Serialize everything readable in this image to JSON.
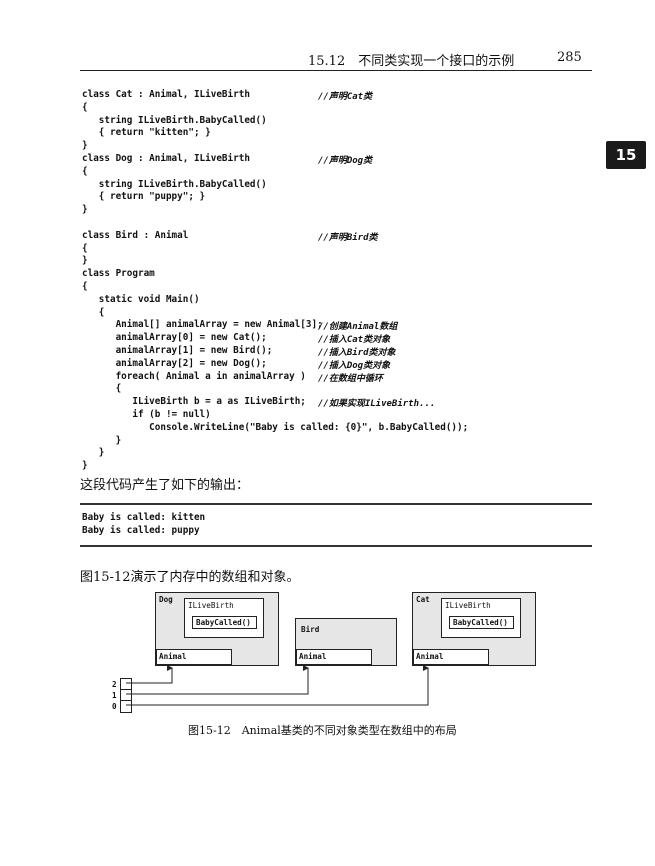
{
  "header": {
    "title": "15.12　不同类实现一个接口的示例",
    "page_number": "285"
  },
  "chapter_tab": "15",
  "code_block_1": {
    "lines": [
      "class Cat : Animal, ILiveBirth",
      "{",
      "   string ILiveBirth.BabyCalled()",
      "   { return \"kitten\"; }",
      "}",
      "class Dog : Animal, ILiveBirth",
      "{",
      "   string ILiveBirth.BabyCalled()",
      "   { return \"puppy\"; }",
      "}",
      "",
      "class Bird : Animal",
      "{",
      "}",
      "class Program",
      "{",
      "   static void Main()",
      "   {",
      "      Animal[] animalArray = new Animal[3];",
      "      animalArray[0] = new Cat();",
      "      animalArray[1] = new Bird();",
      "      animalArray[2] = new Dog();",
      "      foreach( Animal a in animalArray )",
      "      {",
      "         ILiveBirth b = a as ILiveBirth;",
      "         if (b != null)",
      "            Console.WriteLine(\"Baby is called: {0}\", b.BabyCalled());",
      "      }",
      "   }",
      "}"
    ],
    "comments": [
      {
        "line": 0,
        "text": "//声明Cat类"
      },
      {
        "line": 5,
        "text": "//声明Dog类"
      },
      {
        "line": 11,
        "text": "//声明Bird类"
      },
      {
        "line": 18,
        "text": "//创建Animal数组"
      },
      {
        "line": 19,
        "text": "//插入Cat类对象"
      },
      {
        "line": 20,
        "text": "//插入Bird类对象"
      },
      {
        "line": 21,
        "text": "//插入Dog类对象"
      },
      {
        "line": 22,
        "text": "//在数组中循环"
      },
      {
        "line": 24,
        "text": "//如果实现ILiveBirth..."
      }
    ]
  },
  "paragraph_output_intro": "这段代码产生了如下的输出：",
  "output_block": {
    "lines": [
      "Baby is called: kitten",
      "Baby is called: puppy"
    ]
  },
  "paragraph_figure_intro": "图15-12演示了内存中的数组和对象。",
  "figure": {
    "dog": {
      "title": "Dog",
      "interface": "ILiveBirth",
      "method": "BabyCalled()",
      "base": "Animal"
    },
    "bird": {
      "title": "Bird",
      "base": "Animal"
    },
    "cat": {
      "title": "Cat",
      "interface": "ILiveBirth",
      "method": "BabyCalled()",
      "base": "Animal"
    },
    "array_indices": [
      "2",
      "1",
      "0"
    ],
    "caption": "图15-12　Animal基类的不同对象类型在数组中的布局"
  }
}
